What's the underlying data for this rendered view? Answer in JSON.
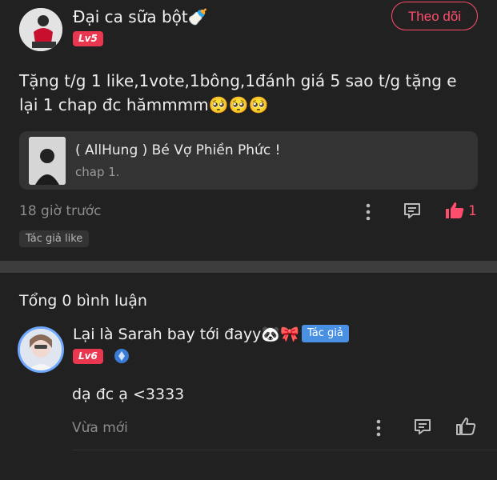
{
  "post": {
    "username": "Đại ca sữa bột🍼",
    "level": "Lv5",
    "follow_label": "Theo dõi",
    "text": "Tặng t/g 1 like,1vote,1bông,1đánh giá 5 sao t/g tặng e lại 1 chap đc hămmmm🥺🥺🥺",
    "reference": {
      "title": "( AllHung ) Bé Vợ Phiền Phức !",
      "subtitle": "chap 1."
    },
    "time": "18 giờ trước",
    "like_count": "1",
    "tag": "Tác giả like",
    "icons": {
      "more": "more-vertical-icon",
      "comment": "comment-icon",
      "like": "thumbs-up-icon"
    },
    "colors": {
      "accent": "#ff4d6d"
    }
  },
  "comments": {
    "total_label": "Tổng 0 bình luận",
    "reply": {
      "username": "Lại là Sarah bay tới đayy🐼🎀",
      "author_tag": "Tác giả",
      "level": "Lv6",
      "text": "dạ đc ạ <3333",
      "time": "Vừa mới"
    },
    "colors": {
      "author_tag": "#4a90e2"
    }
  }
}
